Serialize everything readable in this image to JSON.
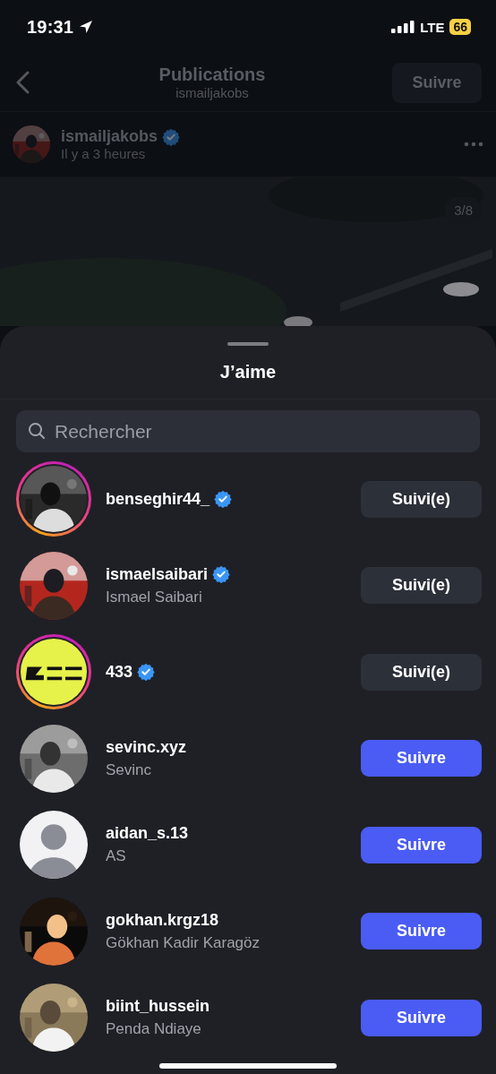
{
  "status_bar": {
    "time": "19:31",
    "network": "LTE",
    "battery": "66"
  },
  "header": {
    "title": "Publications",
    "subtitle": "ismailjakobs",
    "follow_button": "Suivre"
  },
  "post": {
    "username": "ismailjakobs",
    "verified": true,
    "time": "Il y a 3 heures",
    "counter": "3/8"
  },
  "likes_sheet": {
    "title": "J’aime",
    "search": {
      "placeholder": "Rechercher"
    },
    "users": [
      {
        "username": "benseghir44_",
        "verified": true,
        "has_story": true,
        "button": "Suivi(e)",
        "following": true
      },
      {
        "username": "ismaelsaibari",
        "full_name": "Ismael Saibari",
        "verified": true,
        "has_story": false,
        "button": "Suivi(e)",
        "following": true
      },
      {
        "username": "433",
        "verified": true,
        "has_story": true,
        "button": "Suivi(e)",
        "following": true
      },
      {
        "username": "sevinc.xyz",
        "full_name": "Sevinc",
        "verified": false,
        "has_story": false,
        "button": "Suivre",
        "following": false
      },
      {
        "username": "aidan_s.13",
        "full_name": "AS",
        "verified": false,
        "has_story": false,
        "avatar": {
          "kind": "default"
        },
        "button": "Suivre",
        "following": false
      },
      {
        "username": "gokhan.krgz18",
        "full_name": "Gökhan Kadir Karagöz",
        "verified": false,
        "has_story": false,
        "button": "Suivre",
        "following": false
      },
      {
        "username": "biint_hussein",
        "full_name": "Penda Ndiaye",
        "verified": false,
        "has_story": false,
        "button": "Suivre",
        "following": false
      }
    ]
  }
}
